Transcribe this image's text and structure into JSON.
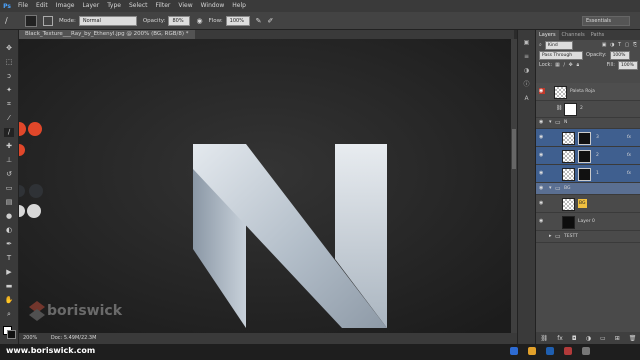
{
  "menubar": {
    "logo": "Ps",
    "items": [
      "File",
      "Edit",
      "Image",
      "Layer",
      "Type",
      "Select",
      "Filter",
      "View",
      "Window",
      "Help"
    ]
  },
  "options": {
    "mode_label": "Mode:",
    "mode_value": "Normal",
    "opacity_label": "Opacity:",
    "opacity_value": "80%",
    "flow_label": "Flow:",
    "flow_value": "100%",
    "workspace": "Essentials"
  },
  "document": {
    "tab_title": "Black_Texture___Ray_by_Ethenyl.jpg @ 200% (BG, RGB/8) *",
    "zoom": "200%",
    "doc_size": "Doc: 5.49M/22.3M",
    "watermark": "boriswick"
  },
  "colors": {
    "swatch_dark": "#2f3236",
    "swatch_light": "#d8d8d8",
    "accent_orange": "#e0472a",
    "letter_light": "#d6dde4",
    "letter_mid": "#a3afbb"
  },
  "layers_panel": {
    "tabs": [
      "Layers",
      "Channels",
      "Paths"
    ],
    "filter_kind": "Kind",
    "blend_mode": "Pass Through",
    "opacity_label": "Opacity:",
    "opacity_value": "100%",
    "lock_label": "Lock:",
    "fill_label": "Fill:",
    "fill_value": "100%",
    "layers": [
      {
        "name": "Paleta Roja",
        "fx": ""
      },
      {
        "name": "2",
        "fx": ""
      },
      {
        "name": "N",
        "fx": ""
      },
      {
        "name": "3",
        "fx": "fx"
      },
      {
        "name": "2",
        "fx": "fx"
      },
      {
        "name": "1",
        "fx": "fx"
      },
      {
        "name": "BG",
        "fx": ""
      },
      {
        "name": "BG",
        "fx": ""
      },
      {
        "name": "Layer 0",
        "fx": ""
      },
      {
        "name": "TESTT",
        "fx": ""
      }
    ]
  },
  "taskbar": {
    "url": "www.boriswick.com"
  }
}
